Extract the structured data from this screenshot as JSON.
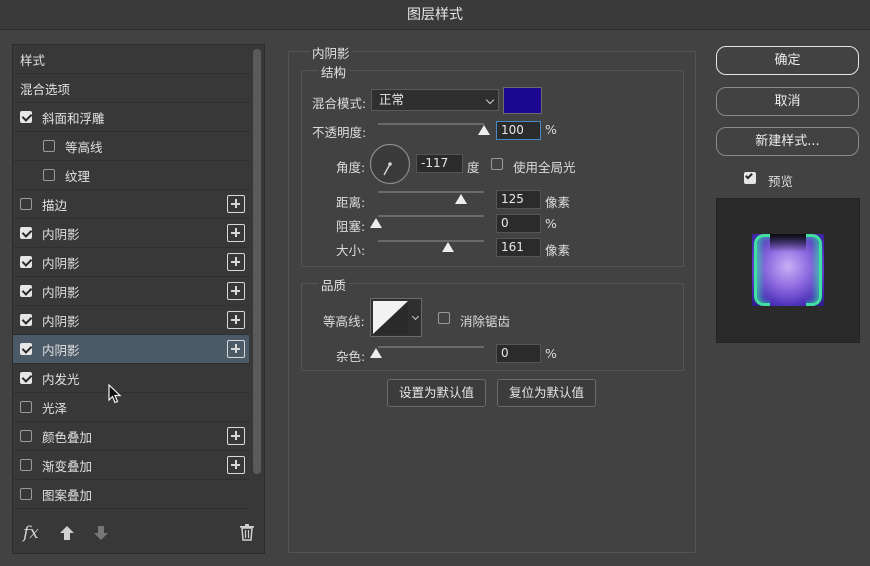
{
  "window": {
    "title": "图层样式"
  },
  "left_panel": {
    "items": [
      {
        "label": "样式",
        "has_checkbox": false,
        "checked": false,
        "indent": false,
        "plus": false,
        "selected": false
      },
      {
        "label": "混合选项",
        "has_checkbox": false,
        "checked": false,
        "indent": false,
        "plus": false,
        "selected": false
      },
      {
        "label": "斜面和浮雕",
        "has_checkbox": true,
        "checked": true,
        "indent": false,
        "plus": false,
        "selected": false
      },
      {
        "label": "等高线",
        "has_checkbox": true,
        "checked": false,
        "indent": true,
        "plus": false,
        "selected": false
      },
      {
        "label": "纹理",
        "has_checkbox": true,
        "checked": false,
        "indent": true,
        "plus": false,
        "selected": false
      },
      {
        "label": "描边",
        "has_checkbox": true,
        "checked": false,
        "indent": false,
        "plus": true,
        "selected": false
      },
      {
        "label": "内阴影",
        "has_checkbox": true,
        "checked": true,
        "indent": false,
        "plus": true,
        "selected": false
      },
      {
        "label": "内阴影",
        "has_checkbox": true,
        "checked": true,
        "indent": false,
        "plus": true,
        "selected": false
      },
      {
        "label": "内阴影",
        "has_checkbox": true,
        "checked": true,
        "indent": false,
        "plus": true,
        "selected": false
      },
      {
        "label": "内阴影",
        "has_checkbox": true,
        "checked": true,
        "indent": false,
        "plus": true,
        "selected": false
      },
      {
        "label": "内阴影",
        "has_checkbox": true,
        "checked": true,
        "indent": false,
        "plus": true,
        "selected": true
      },
      {
        "label": "内发光",
        "has_checkbox": true,
        "checked": true,
        "indent": false,
        "plus": false,
        "selected": false
      },
      {
        "label": "光泽",
        "has_checkbox": true,
        "checked": false,
        "indent": false,
        "plus": false,
        "selected": false
      },
      {
        "label": "颜色叠加",
        "has_checkbox": true,
        "checked": false,
        "indent": false,
        "plus": true,
        "selected": false
      },
      {
        "label": "渐变叠加",
        "has_checkbox": true,
        "checked": false,
        "indent": false,
        "plus": true,
        "selected": false
      },
      {
        "label": "图案叠加",
        "has_checkbox": true,
        "checked": false,
        "indent": false,
        "plus": false,
        "selected": false
      }
    ],
    "footer": {
      "fx_label": "fx"
    }
  },
  "inner_shadow": {
    "section_title": "内阴影",
    "structure": {
      "title": "结构",
      "blend_mode_label": "混合模式:",
      "blend_mode_value": "正常",
      "shadow_color": "#1c0890",
      "opacity_label": "不透明度:",
      "opacity_value": "100",
      "opacity_unit": "%",
      "opacity_fraction": 1.0,
      "angle_label": "角度:",
      "angle_value": "-117",
      "angle_unit": "度",
      "global_light_label": "使用全局光",
      "global_light_checked": false,
      "distance_label": "距离:",
      "distance_value": "125",
      "distance_unit": "像素",
      "choke_label": "阻塞:",
      "choke_value": "0",
      "choke_unit": "%",
      "size_label": "大小:",
      "size_value": "161",
      "size_unit": "像素"
    },
    "quality": {
      "title": "品质",
      "contour_label": "等高线:",
      "anti_alias_label": "消除锯齿",
      "anti_alias_checked": false,
      "noise_label": "杂色:",
      "noise_value": "0",
      "noise_unit": "%"
    },
    "buttons": {
      "make_default": "设置为默认值",
      "reset_default": "复位为默认值"
    }
  },
  "right_panel": {
    "ok": "确定",
    "cancel": "取消",
    "new_style": "新建样式...",
    "preview_label": "预览",
    "preview_checked": true
  },
  "colors": {
    "accent_focus": "#4a87c8",
    "selected_row": "#4c5a68"
  }
}
